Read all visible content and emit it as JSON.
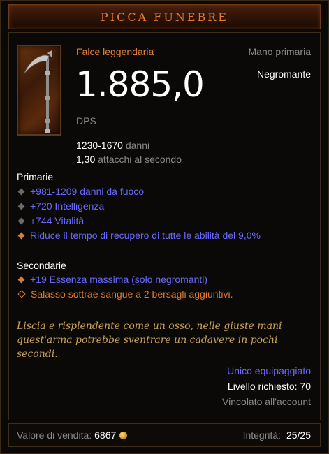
{
  "item": {
    "name": "PICCA FUNEBRE",
    "type": "Falce leggendaria",
    "slot": "Mano primaria",
    "class_restriction": "Negromante",
    "dps_value": "1.885,0",
    "dps_label": "DPS",
    "damage_value": "1230-1670",
    "damage_label": "danni",
    "speed_value": "1,30",
    "speed_label": "attacchi al secondo"
  },
  "primary": {
    "header": "Primarie",
    "affixes": [
      {
        "text": "+981-1209 danni da fuoco",
        "bullet": "grey",
        "color": "#6969ff"
      },
      {
        "text": "+720 Intelligenza",
        "bullet": "grey",
        "color": "#6969ff"
      },
      {
        "text": "+744 Vitalità",
        "bullet": "grey",
        "color": "#6969ff"
      },
      {
        "text": "Riduce il tempo di recupero di tutte le abilità del 9,0%",
        "bullet": "orange",
        "color": "#6969ff"
      }
    ]
  },
  "secondary": {
    "header": "Secondarie",
    "affixes": [
      {
        "text": "+19 Essenza massima (solo negromanti)",
        "bullet": "orange",
        "color": "#6969ff"
      },
      {
        "text": "Salasso sottrae sangue a 2 bersagli aggiuntivi.",
        "bullet": "orange-hollow",
        "color": "#e07a2c"
      }
    ]
  },
  "flavor_text": "Liscia e risplendente come un osso, nelle giuste mani quest'arma potrebbe sventrare un cadavere in pochi secondi.",
  "requirements": {
    "unique_equipped": "Unico equipaggiato",
    "level_label": "Livello richiesto:",
    "level_value": "70",
    "bound": "Vincolato all'account"
  },
  "footer": {
    "sell_label": "Valore di vendita:",
    "sell_value": "6867",
    "currency_icon": "gold-coin-icon",
    "durability_label": "Integrità:",
    "durability_value": "25/25"
  },
  "colors": {
    "title": "#e47b32",
    "legendary": "#e4803a",
    "magic_affix": "#6969ff",
    "legendary_affix": "#e07a2c",
    "flavor": "#c8a35a"
  },
  "icons": {
    "item_icon": "scythe-icon"
  }
}
